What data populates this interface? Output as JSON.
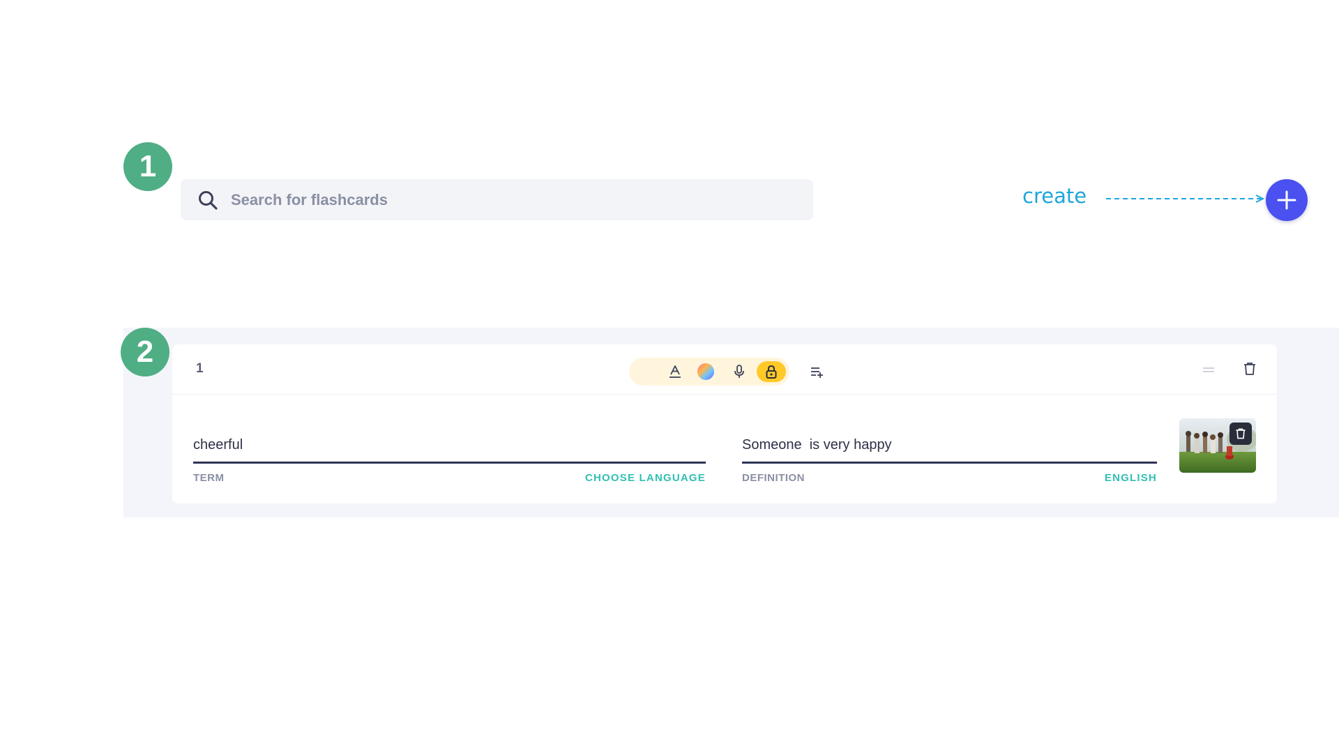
{
  "steps": {
    "step1": "1",
    "step2": "2"
  },
  "search": {
    "placeholder": "Search for flashcards",
    "value": ""
  },
  "create": {
    "label": "create",
    "button_icon": "plus-icon"
  },
  "card": {
    "number": "1",
    "toolbar": {
      "icons": [
        "text-format-icon",
        "color-palette-icon",
        "microphone-icon",
        "lock-icon",
        "insert-list-icon"
      ]
    },
    "term": {
      "value": "cheerful",
      "label": "TERM",
      "language": "CHOOSE LANGUAGE"
    },
    "definition": {
      "value": "Someone  is very happy",
      "label": "DEFINITION",
      "language": "ENGLISH"
    },
    "image_icon": "trash-icon"
  },
  "colors": {
    "badge": "#4fae84",
    "create_text": "#1ea6dc",
    "add_button": "#4b50f0",
    "language_link": "#31bfb2",
    "lock_highlight": "#ffc928",
    "tool_pill": "#fff5dd"
  }
}
